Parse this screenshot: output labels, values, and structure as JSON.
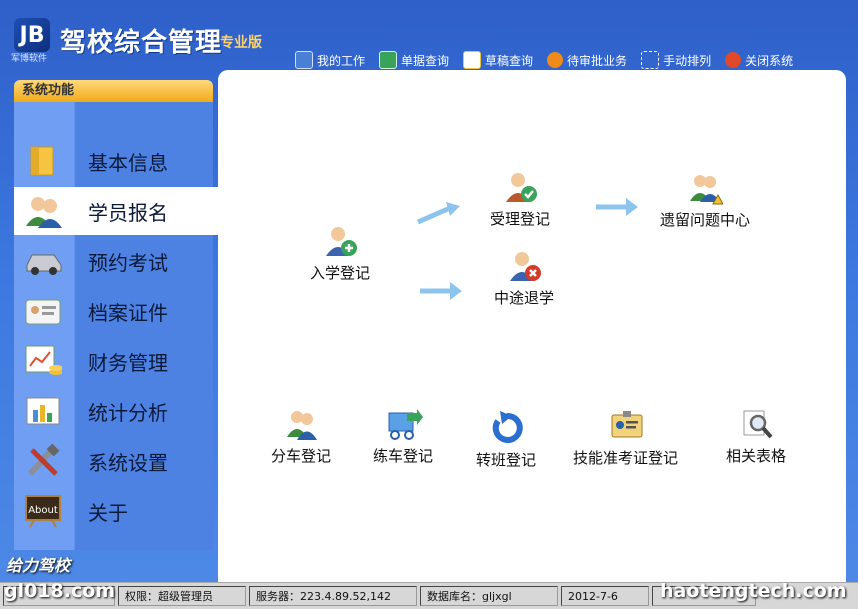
{
  "app": {
    "logo_text": "JB",
    "logo_sub": "军博软件",
    "title": "驾校综合管理",
    "edition": "专业版"
  },
  "toolbar": [
    {
      "label": "我的工作",
      "icon": "work-icon",
      "color": "#4a7fd6"
    },
    {
      "label": "单据查询",
      "icon": "receipt-search-icon",
      "color": "#3aa35a"
    },
    {
      "label": "草稿查询",
      "icon": "draft-icon",
      "color": "#e9c44a"
    },
    {
      "label": "待审批业务",
      "icon": "approval-icon",
      "color": "#f08a1a"
    },
    {
      "label": "手动排列",
      "icon": "arrange-icon",
      "color": "#e6e6e6"
    },
    {
      "label": "关闭系统",
      "icon": "power-icon",
      "color": "#e04a2a"
    }
  ],
  "sidebar": {
    "header": "系统功能",
    "items": [
      {
        "label": "基本信息",
        "icon": "folder-icon",
        "active": false
      },
      {
        "label": "学员报名",
        "icon": "users-icon",
        "active": true
      },
      {
        "label": "预约考试",
        "icon": "car-icon",
        "active": false
      },
      {
        "label": "档案证件",
        "icon": "id-card-icon",
        "active": false
      },
      {
        "label": "财务管理",
        "icon": "finance-icon",
        "active": false
      },
      {
        "label": "统计分析",
        "icon": "chart-icon",
        "active": false
      },
      {
        "label": "系统设置",
        "icon": "tools-icon",
        "active": false
      },
      {
        "label": "关于",
        "icon": "about-icon",
        "active": false
      }
    ]
  },
  "main": {
    "functions": {
      "enroll": "入学登记",
      "accept": "受理登记",
      "quit": "中途退学",
      "issues": "遗留问题中心",
      "assign_car": "分车登记",
      "practice": "练车登记",
      "transfer": "转班登记",
      "skill_cert": "技能准考证登记",
      "forms": "相关表格"
    },
    "about_icon_text": "About"
  },
  "statusbar": {
    "user": "gl018.com",
    "permission": "权限：超级管理员",
    "server": "服务器：223.4.89.52,142",
    "database": "数据库名：gljxgl",
    "date": "2012-7-6"
  },
  "watermarks": {
    "left": "给力驾校",
    "right": "haotengtech.com"
  }
}
